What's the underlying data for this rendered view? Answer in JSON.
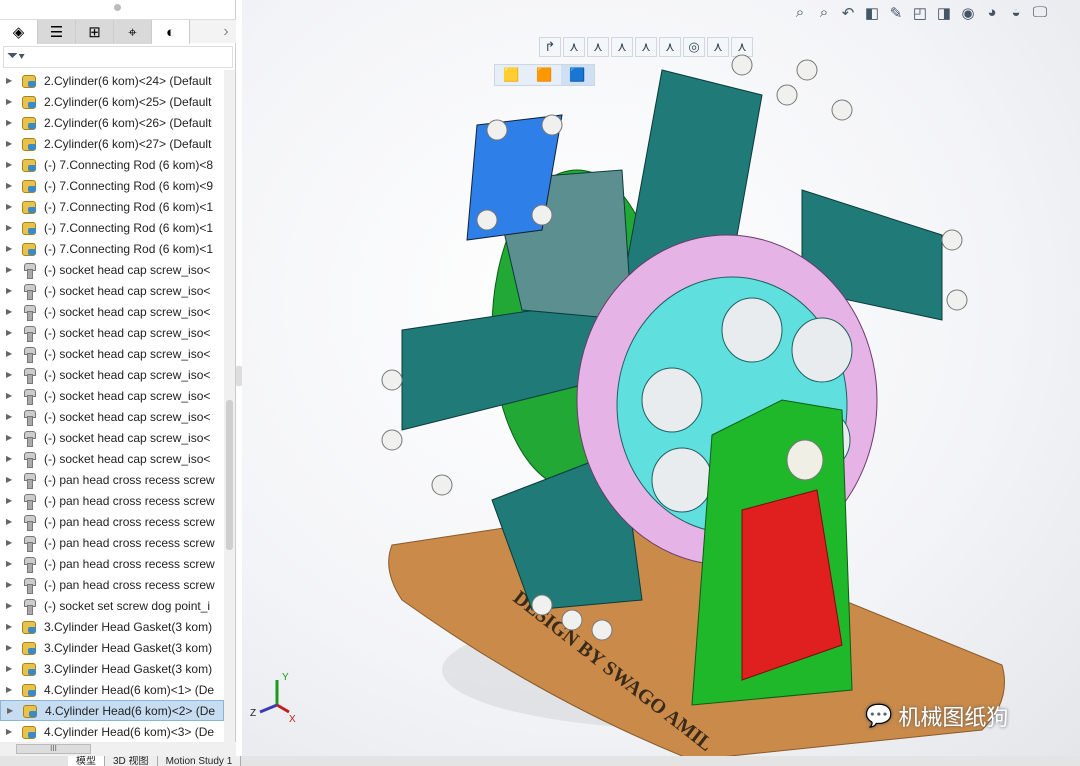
{
  "panel_tabs": [
    {
      "icon": "feature-manager-icon",
      "glyph": "◈"
    },
    {
      "icon": "property-manager-icon",
      "glyph": "☰"
    },
    {
      "icon": "configuration-manager-icon",
      "glyph": "⊞"
    },
    {
      "icon": "dimxpert-icon",
      "glyph": "⌖"
    },
    {
      "icon": "display-manager-icon",
      "glyph": "◐"
    }
  ],
  "filter_icon": "filter-icon",
  "tree": [
    {
      "label": "2.Cylinder(6 kom)<24> (Default",
      "type": "asm"
    },
    {
      "label": "2.Cylinder(6 kom)<25> (Default",
      "type": "asm"
    },
    {
      "label": "2.Cylinder(6 kom)<26> (Default",
      "type": "asm"
    },
    {
      "label": "2.Cylinder(6 kom)<27> (Default",
      "type": "asm"
    },
    {
      "label": "(-) 7.Connecting Rod (6 kom)<8",
      "type": "asm"
    },
    {
      "label": "(-) 7.Connecting Rod (6 kom)<9",
      "type": "asm"
    },
    {
      "label": "(-) 7.Connecting Rod (6 kom)<1",
      "type": "asm"
    },
    {
      "label": "(-) 7.Connecting Rod (6 kom)<1",
      "type": "asm"
    },
    {
      "label": "(-) 7.Connecting Rod (6 kom)<1",
      "type": "asm"
    },
    {
      "label": "(-) socket head cap screw_iso<",
      "type": "scr"
    },
    {
      "label": "(-) socket head cap screw_iso<",
      "type": "scr"
    },
    {
      "label": "(-) socket head cap screw_iso<",
      "type": "scr"
    },
    {
      "label": "(-) socket head cap screw_iso<",
      "type": "scr"
    },
    {
      "label": "(-) socket head cap screw_iso<",
      "type": "scr"
    },
    {
      "label": "(-) socket head cap screw_iso<",
      "type": "scr"
    },
    {
      "label": "(-) socket head cap screw_iso<",
      "type": "scr"
    },
    {
      "label": "(-) socket head cap screw_iso<",
      "type": "scr"
    },
    {
      "label": "(-) socket head cap screw_iso<",
      "type": "scr"
    },
    {
      "label": "(-) socket head cap screw_iso<",
      "type": "scr"
    },
    {
      "label": "(-) pan head cross recess screw",
      "type": "scr"
    },
    {
      "label": "(-) pan head cross recess screw",
      "type": "scr"
    },
    {
      "label": "(-) pan head cross recess screw",
      "type": "scr"
    },
    {
      "label": "(-) pan head cross recess screw",
      "type": "scr"
    },
    {
      "label": "(-) pan head cross recess screw",
      "type": "scr"
    },
    {
      "label": "(-) pan head cross recess screw",
      "type": "scr"
    },
    {
      "label": "(-) socket set screw dog point_i",
      "type": "scr"
    },
    {
      "label": "3.Cylinder Head Gasket(3 kom)",
      "type": "asm"
    },
    {
      "label": "3.Cylinder Head Gasket(3 kom)",
      "type": "asm"
    },
    {
      "label": "3.Cylinder Head Gasket(3 kom)",
      "type": "asm"
    },
    {
      "label": "4.Cylinder Head(6 kom)<1> (De",
      "type": "asm"
    },
    {
      "label": "4.Cylinder Head(6 kom)<2> (De",
      "type": "asm",
      "selected": true
    },
    {
      "label": "4.Cylinder Head(6 kom)<3> (De",
      "type": "asm"
    }
  ],
  "bottom_tabs": [
    "模型",
    "3D 视图",
    "Motion Study 1"
  ],
  "view_toolbar": [
    "zoom-to-fit-icon",
    "zoom-area-icon",
    "previous-view-icon",
    "section-view-icon",
    "dynamic-annotation-icon",
    "view-orientation-icon",
    "display-style-icon",
    "hide-show-icon",
    "edit-appearance-icon",
    "apply-scene-icon",
    "view-settings-icon"
  ],
  "base_engraving": "DESIGN BY SWAGO AMIL",
  "axes": {
    "x": "X",
    "y": "Y",
    "z": "Z"
  },
  "watermark": "机械图纸狗",
  "colors": {
    "cylinder": "#1f7a78",
    "flywheel": "#e6b3e6",
    "disc": "#5fe0df",
    "stand": "#1fb82a",
    "window": "#e0201e",
    "base": "#c98a4a",
    "selected_face": "#2f7fe8"
  }
}
